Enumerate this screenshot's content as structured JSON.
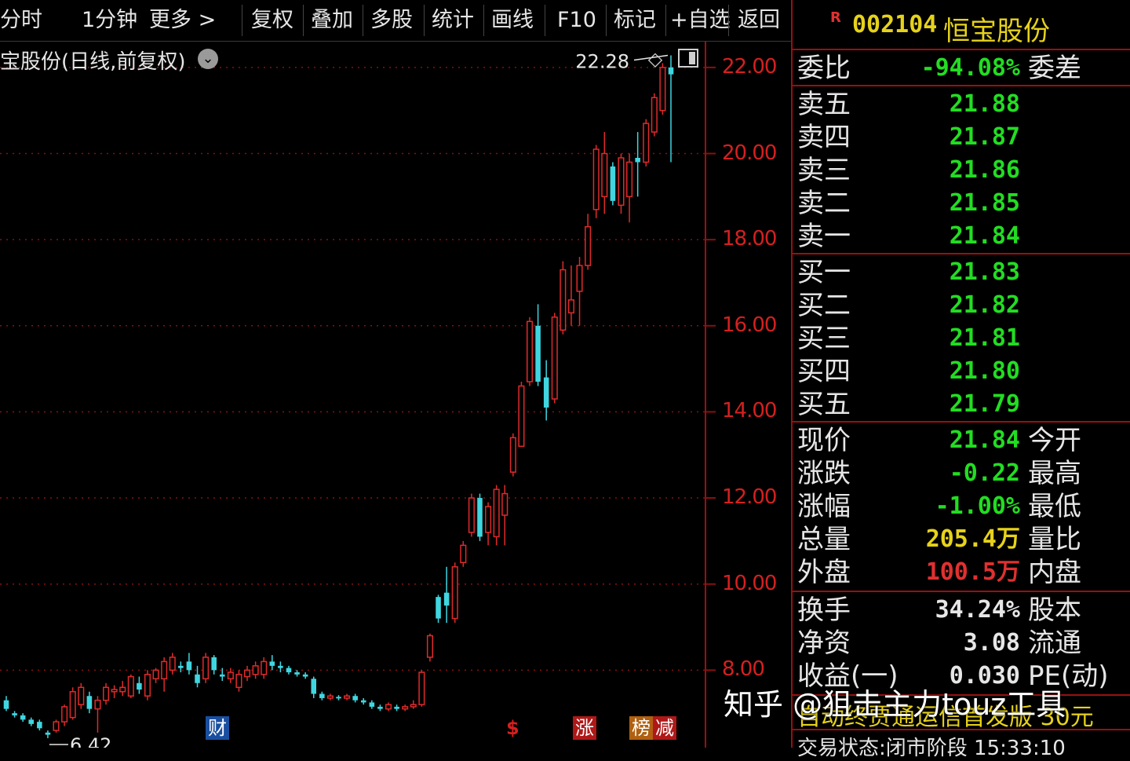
{
  "toolbar": {
    "items": [
      "分时",
      "1分钟",
      "更多 >",
      "复权",
      "叠加",
      "多股",
      "统计",
      "画线",
      "F10",
      "标记",
      "+自选",
      "返回"
    ]
  },
  "chart": {
    "title": "宝股份(日线,前复权)",
    "y_labels": [
      "22.00",
      "20.00",
      "18.00",
      "16.00",
      "14.00",
      "12.00",
      "10.00",
      "8.00"
    ],
    "max_label": "22.28",
    "min_label": "6.42",
    "badges": [
      {
        "text": "财",
        "color": "#1a4fa0"
      },
      {
        "text": "$",
        "color": "#d42020"
      },
      {
        "text": "涨",
        "color": "#b01818"
      },
      {
        "text": "榜",
        "color": "#b06010"
      },
      {
        "text": "减",
        "color": "#b01818"
      }
    ]
  },
  "chart_data": {
    "type": "candlestick",
    "ylim": [
      6.2,
      22.6
    ],
    "gridlines": [
      8,
      10,
      12,
      14,
      16,
      18,
      20,
      22
    ],
    "candles": [
      {
        "o": 7.3,
        "h": 7.4,
        "l": 7.05,
        "c": 7.1
      },
      {
        "o": 7.0,
        "h": 7.05,
        "l": 6.9,
        "c": 6.95
      },
      {
        "o": 6.95,
        "h": 7.0,
        "l": 6.8,
        "c": 6.85
      },
      {
        "o": 6.85,
        "h": 6.9,
        "l": 6.7,
        "c": 6.75
      },
      {
        "o": 6.8,
        "h": 6.85,
        "l": 6.6,
        "c": 6.65
      },
      {
        "o": 6.55,
        "h": 6.6,
        "l": 6.42,
        "c": 6.5
      },
      {
        "o": 6.6,
        "h": 6.85,
        "l": 6.55,
        "c": 6.8
      },
      {
        "o": 6.8,
        "h": 7.2,
        "l": 6.7,
        "c": 7.15
      },
      {
        "o": 6.9,
        "h": 7.6,
        "l": 6.85,
        "c": 7.5
      },
      {
        "o": 7.2,
        "h": 7.7,
        "l": 7.1,
        "c": 7.6
      },
      {
        "o": 7.4,
        "h": 7.5,
        "l": 7.0,
        "c": 7.1
      },
      {
        "o": 7.1,
        "h": 7.4,
        "l": 6.55,
        "c": 7.3
      },
      {
        "o": 7.3,
        "h": 7.7,
        "l": 7.2,
        "c": 7.6
      },
      {
        "o": 7.5,
        "h": 7.65,
        "l": 7.35,
        "c": 7.55
      },
      {
        "o": 7.5,
        "h": 7.75,
        "l": 7.4,
        "c": 7.6
      },
      {
        "o": 7.4,
        "h": 7.9,
        "l": 7.35,
        "c": 7.85
      },
      {
        "o": 7.7,
        "h": 7.85,
        "l": 7.45,
        "c": 7.55
      },
      {
        "o": 7.4,
        "h": 8.0,
        "l": 7.3,
        "c": 7.9
      },
      {
        "o": 7.8,
        "h": 8.05,
        "l": 7.7,
        "c": 8.0
      },
      {
        "o": 7.8,
        "h": 8.3,
        "l": 7.5,
        "c": 8.2
      },
      {
        "o": 8.0,
        "h": 8.4,
        "l": 7.9,
        "c": 8.3
      },
      {
        "o": 8.1,
        "h": 8.2,
        "l": 7.95,
        "c": 8.05
      },
      {
        "o": 8.2,
        "h": 8.4,
        "l": 7.9,
        "c": 8.0
      },
      {
        "o": 7.9,
        "h": 8.1,
        "l": 7.6,
        "c": 7.7
      },
      {
        "o": 7.8,
        "h": 8.4,
        "l": 7.7,
        "c": 8.3
      },
      {
        "o": 8.3,
        "h": 8.35,
        "l": 7.9,
        "c": 8.0
      },
      {
        "o": 7.9,
        "h": 8.05,
        "l": 7.75,
        "c": 7.85
      },
      {
        "o": 7.8,
        "h": 8.05,
        "l": 7.7,
        "c": 7.95
      },
      {
        "o": 7.6,
        "h": 8.0,
        "l": 7.5,
        "c": 7.9
      },
      {
        "o": 7.85,
        "h": 8.1,
        "l": 7.75,
        "c": 8.0
      },
      {
        "o": 7.9,
        "h": 8.2,
        "l": 7.8,
        "c": 8.1
      },
      {
        "o": 7.9,
        "h": 8.3,
        "l": 7.8,
        "c": 8.2
      },
      {
        "o": 8.2,
        "h": 8.35,
        "l": 8.0,
        "c": 8.1
      },
      {
        "o": 8.1,
        "h": 8.2,
        "l": 7.95,
        "c": 8.05
      },
      {
        "o": 8.05,
        "h": 8.1,
        "l": 7.9,
        "c": 7.95
      },
      {
        "o": 7.95,
        "h": 8.0,
        "l": 7.85,
        "c": 7.9
      },
      {
        "o": 7.9,
        "h": 7.95,
        "l": 7.8,
        "c": 7.85
      },
      {
        "o": 7.8,
        "h": 7.85,
        "l": 7.35,
        "c": 7.45
      },
      {
        "o": 7.45,
        "h": 7.5,
        "l": 7.3,
        "c": 7.35
      },
      {
        "o": 7.35,
        "h": 7.45,
        "l": 7.3,
        "c": 7.4
      },
      {
        "o": 7.38,
        "h": 7.42,
        "l": 7.3,
        "c": 7.35
      },
      {
        "o": 7.35,
        "h": 7.45,
        "l": 7.3,
        "c": 7.4
      },
      {
        "o": 7.4,
        "h": 7.45,
        "l": 7.25,
        "c": 7.3
      },
      {
        "o": 7.3,
        "h": 7.35,
        "l": 7.2,
        "c": 7.25
      },
      {
        "o": 7.25,
        "h": 7.3,
        "l": 7.1,
        "c": 7.15
      },
      {
        "o": 7.15,
        "h": 7.2,
        "l": 7.05,
        "c": 7.1
      },
      {
        "o": 7.1,
        "h": 7.25,
        "l": 7.05,
        "c": 7.2
      },
      {
        "o": 7.15,
        "h": 7.2,
        "l": 7.05,
        "c": 7.1
      },
      {
        "o": 7.1,
        "h": 7.2,
        "l": 7.05,
        "c": 7.15
      },
      {
        "o": 7.15,
        "h": 7.3,
        "l": 7.1,
        "c": 7.2
      },
      {
        "o": 7.2,
        "h": 8.0,
        "l": 7.15,
        "c": 7.95
      },
      {
        "o": 8.3,
        "h": 8.85,
        "l": 8.2,
        "c": 8.8
      },
      {
        "o": 9.7,
        "h": 9.75,
        "l": 9.1,
        "c": 9.2
      },
      {
        "o": 9.8,
        "h": 10.4,
        "l": 9.1,
        "c": 9.5
      },
      {
        "o": 9.2,
        "h": 10.5,
        "l": 9.1,
        "c": 10.4
      },
      {
        "o": 10.5,
        "h": 11.0,
        "l": 10.4,
        "c": 10.9
      },
      {
        "o": 11.2,
        "h": 12.1,
        "l": 11.1,
        "c": 12.0
      },
      {
        "o": 12.0,
        "h": 12.1,
        "l": 11.0,
        "c": 11.1
      },
      {
        "o": 11.2,
        "h": 11.9,
        "l": 10.9,
        "c": 11.8
      },
      {
        "o": 11.1,
        "h": 12.3,
        "l": 10.9,
        "c": 12.2
      },
      {
        "o": 11.6,
        "h": 12.3,
        "l": 10.9,
        "c": 12.1
      },
      {
        "o": 12.6,
        "h": 13.5,
        "l": 12.5,
        "c": 13.4
      },
      {
        "o": 13.2,
        "h": 14.7,
        "l": 13.2,
        "c": 14.6
      },
      {
        "o": 14.7,
        "h": 16.2,
        "l": 14.6,
        "c": 16.1
      },
      {
        "o": 16.0,
        "h": 16.5,
        "l": 14.6,
        "c": 14.7
      },
      {
        "o": 14.8,
        "h": 15.2,
        "l": 13.8,
        "c": 14.1
      },
      {
        "o": 14.3,
        "h": 16.3,
        "l": 14.2,
        "c": 16.2
      },
      {
        "o": 15.9,
        "h": 17.5,
        "l": 15.8,
        "c": 17.3
      },
      {
        "o": 16.3,
        "h": 17.4,
        "l": 16.0,
        "c": 16.6
      },
      {
        "o": 16.8,
        "h": 17.6,
        "l": 16.0,
        "c": 17.4
      },
      {
        "o": 17.4,
        "h": 18.6,
        "l": 17.3,
        "c": 18.3
      },
      {
        "o": 18.7,
        "h": 20.2,
        "l": 18.5,
        "c": 20.1
      },
      {
        "o": 19.0,
        "h": 20.5,
        "l": 18.6,
        "c": 20.0
      },
      {
        "o": 19.7,
        "h": 19.8,
        "l": 18.8,
        "c": 18.9
      },
      {
        "o": 18.8,
        "h": 20.0,
        "l": 18.6,
        "c": 19.9
      },
      {
        "o": 19.0,
        "h": 20.0,
        "l": 18.4,
        "c": 19.8
      },
      {
        "o": 19.9,
        "h": 20.5,
        "l": 19.0,
        "c": 19.8
      },
      {
        "o": 19.8,
        "h": 20.8,
        "l": 19.7,
        "c": 20.7
      },
      {
        "o": 20.5,
        "h": 21.4,
        "l": 20.4,
        "c": 21.3
      },
      {
        "o": 21.0,
        "h": 22.1,
        "l": 20.9,
        "c": 22.0
      },
      {
        "o": 22.0,
        "h": 22.28,
        "l": 19.8,
        "c": 21.84
      }
    ]
  },
  "quote": {
    "flag": "R",
    "code": "002104",
    "name": "恒宝股份",
    "weibi": {
      "label": "委比",
      "value": "-94.08%",
      "label2": "委差"
    },
    "sell": [
      {
        "label": "卖五",
        "value": "21.88"
      },
      {
        "label": "卖四",
        "value": "21.87"
      },
      {
        "label": "卖三",
        "value": "21.86"
      },
      {
        "label": "卖二",
        "value": "21.85"
      },
      {
        "label": "卖一",
        "value": "21.84"
      }
    ],
    "buy": [
      {
        "label": "买一",
        "value": "21.83"
      },
      {
        "label": "买二",
        "value": "21.82"
      },
      {
        "label": "买三",
        "value": "21.81"
      },
      {
        "label": "买四",
        "value": "21.80"
      },
      {
        "label": "买五",
        "value": "21.79"
      }
    ],
    "stats": [
      {
        "label": "现价",
        "value": "21.84",
        "label2": "今开",
        "color": "#22dd22"
      },
      {
        "label": "涨跌",
        "value": "-0.22",
        "label2": "最高",
        "color": "#22dd22"
      },
      {
        "label": "涨幅",
        "value": "-1.00%",
        "label2": "最低",
        "color": "#22dd22"
      },
      {
        "label": "总量",
        "value": "205.4万",
        "label2": "量比",
        "color": "#e6d21a"
      },
      {
        "label": "外盘",
        "value": "100.5万",
        "label2": "内盘",
        "color": "#e03030"
      }
    ],
    "stats2": [
      {
        "label": "换手",
        "value": "34.24%",
        "label2": "股本"
      },
      {
        "label": "净资",
        "value": "3.08",
        "label2": "流通"
      },
      {
        "label": "收益(一)",
        "value": "0.030",
        "label2": "PE(动)"
      }
    ],
    "ticker": "自动终贾通运信首发版 30元",
    "status": "交易状态:闭市阶段 15:33:10"
  },
  "watermark": "知乎 @狙击主力touz工具",
  "colors": {
    "up": "#e02a2a",
    "down": "#3fd6e0",
    "grid": "#8a1010",
    "ask": "#22dd22"
  }
}
